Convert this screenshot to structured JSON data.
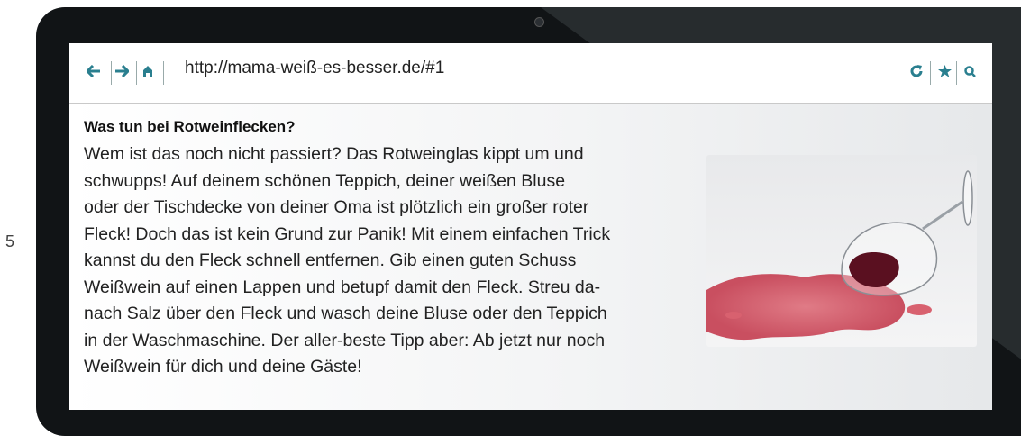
{
  "line_number": "5",
  "browser": {
    "url": "http://mama-weiß-es-besser.de/#1",
    "icons": [
      "back-arrow-icon",
      "forward-arrow-icon",
      "home-icon",
      "reload-icon",
      "star-icon",
      "search-icon"
    ],
    "accent_color": "#2a7f8f"
  },
  "article": {
    "title": "Was tun bei Rotweinflecken?",
    "lines": [
      "Wem ist das noch nicht passiert? Das Rotweinglas kippt um und",
      "schwupps! Auf deinem schönen Teppich, deiner weißen Bluse",
      "oder der Tischdecke von deiner Oma ist plötzlich ein großer roter",
      "Fleck! Doch das ist kein Grund zur Panik! Mit einem einfachen Trick",
      "kannst du den Fleck schnell entfernen. Gib einen guten Schuss",
      "Weißwein auf einen Lappen und betupf damit den Fleck. Streu da-",
      "nach Salz über den Fleck und wasch deine Bluse oder den Teppich",
      "in der Waschmaschine. Der aller-beste Tipp aber: Ab jetzt nur noch",
      "Weißwein für dich und deine Gäste!"
    ],
    "image": "spilled-red-wine-glass"
  }
}
